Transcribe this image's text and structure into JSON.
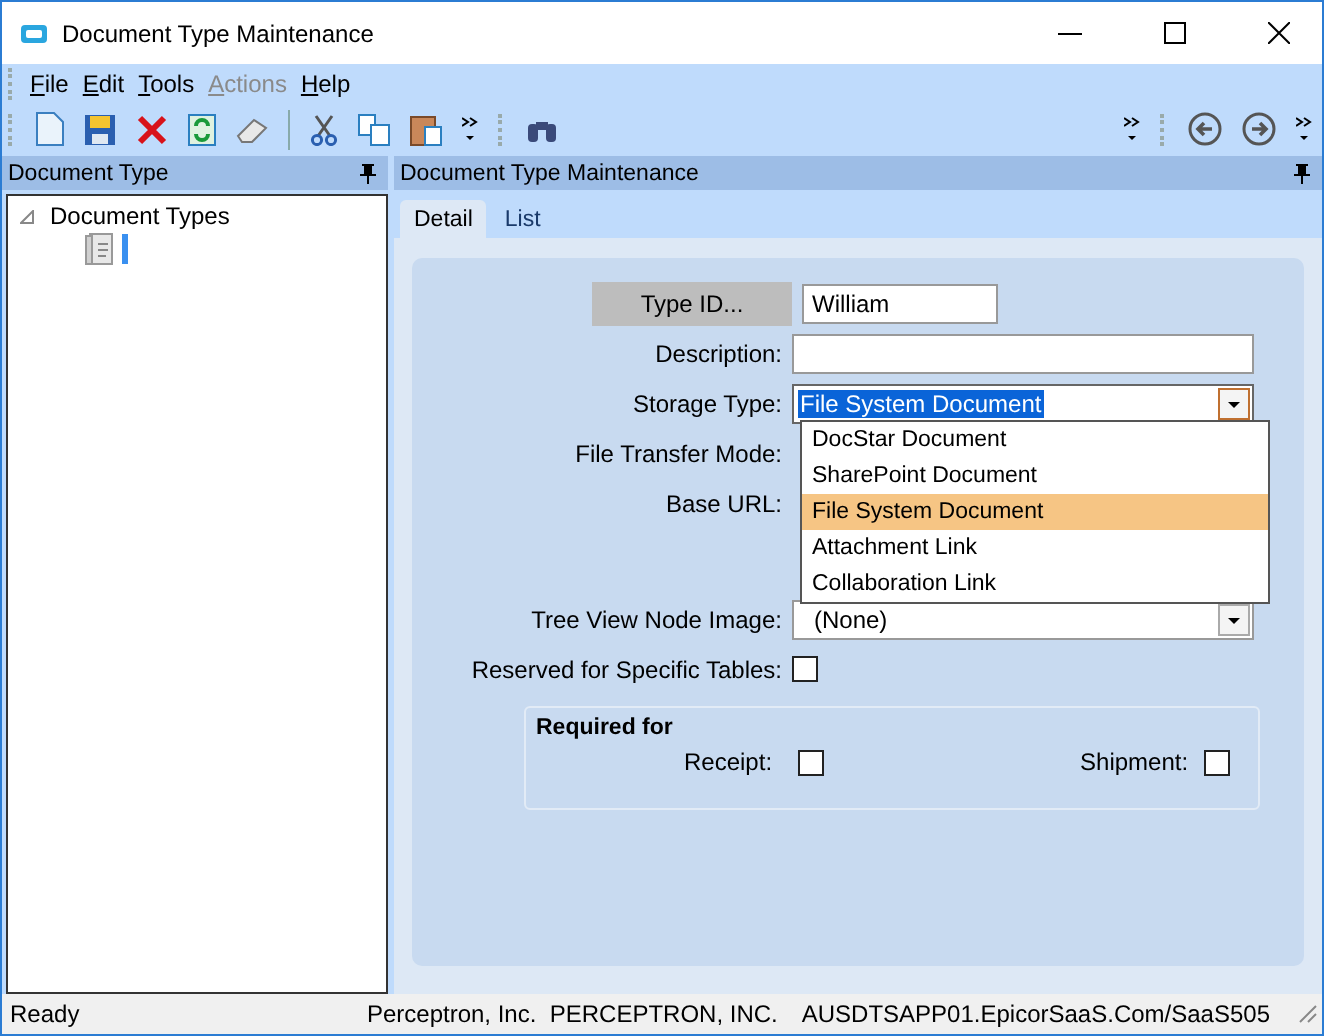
{
  "window": {
    "title": "Document Type Maintenance"
  },
  "menu": [
    {
      "label": "File",
      "disabled": false
    },
    {
      "label": "Edit",
      "disabled": false
    },
    {
      "label": "Tools",
      "disabled": false
    },
    {
      "label": "Actions",
      "disabled": true
    },
    {
      "label": "Help",
      "disabled": false
    }
  ],
  "left_panel": {
    "title": "Document Type",
    "tree": [
      {
        "label": "Document Types",
        "expanded": true,
        "children": [
          {
            "kind": "book",
            "editing": true
          }
        ]
      }
    ]
  },
  "right_panel": {
    "title": "Document Type Maintenance",
    "tabs": [
      {
        "label": "Detail",
        "selected": true
      },
      {
        "label": "List",
        "selected": false
      }
    ],
    "form": {
      "type_id": {
        "label": "Type ID...",
        "value": "William"
      },
      "description": {
        "label": "Description:"
      },
      "storage_type": {
        "label": "Storage Type:",
        "value": "File System Document",
        "expanded": true,
        "options": [
          {
            "label": "DocStar Document",
            "selected": false
          },
          {
            "label": "SharePoint Document",
            "selected": false
          },
          {
            "label": "File System Document",
            "selected": true
          },
          {
            "label": "Attachment Link",
            "selected": false
          },
          {
            "label": "Collaboration Link",
            "selected": false
          }
        ]
      },
      "file_transfer_mode": {
        "label": "File Transfer Mode:"
      },
      "base_url": {
        "label": "Base URL:"
      },
      "tree_view_node_image": {
        "label": "Tree View Node Image:",
        "value": "(None)"
      },
      "reserved_for_specific_tables": {
        "label": "Reserved for Specific Tables:",
        "checked": false
      },
      "required_for": {
        "title": "Required for",
        "receipt": {
          "label": "Receipt:",
          "checked": false
        },
        "shipment": {
          "label": "Shipment:",
          "checked": false
        }
      }
    }
  },
  "status_bar": {
    "left": "Ready",
    "company": "Perceptron, Inc.  PERCEPTRON, INC.",
    "server": "AUSDTSAPP01.EpicorSaaS.Com/SaaS505"
  }
}
